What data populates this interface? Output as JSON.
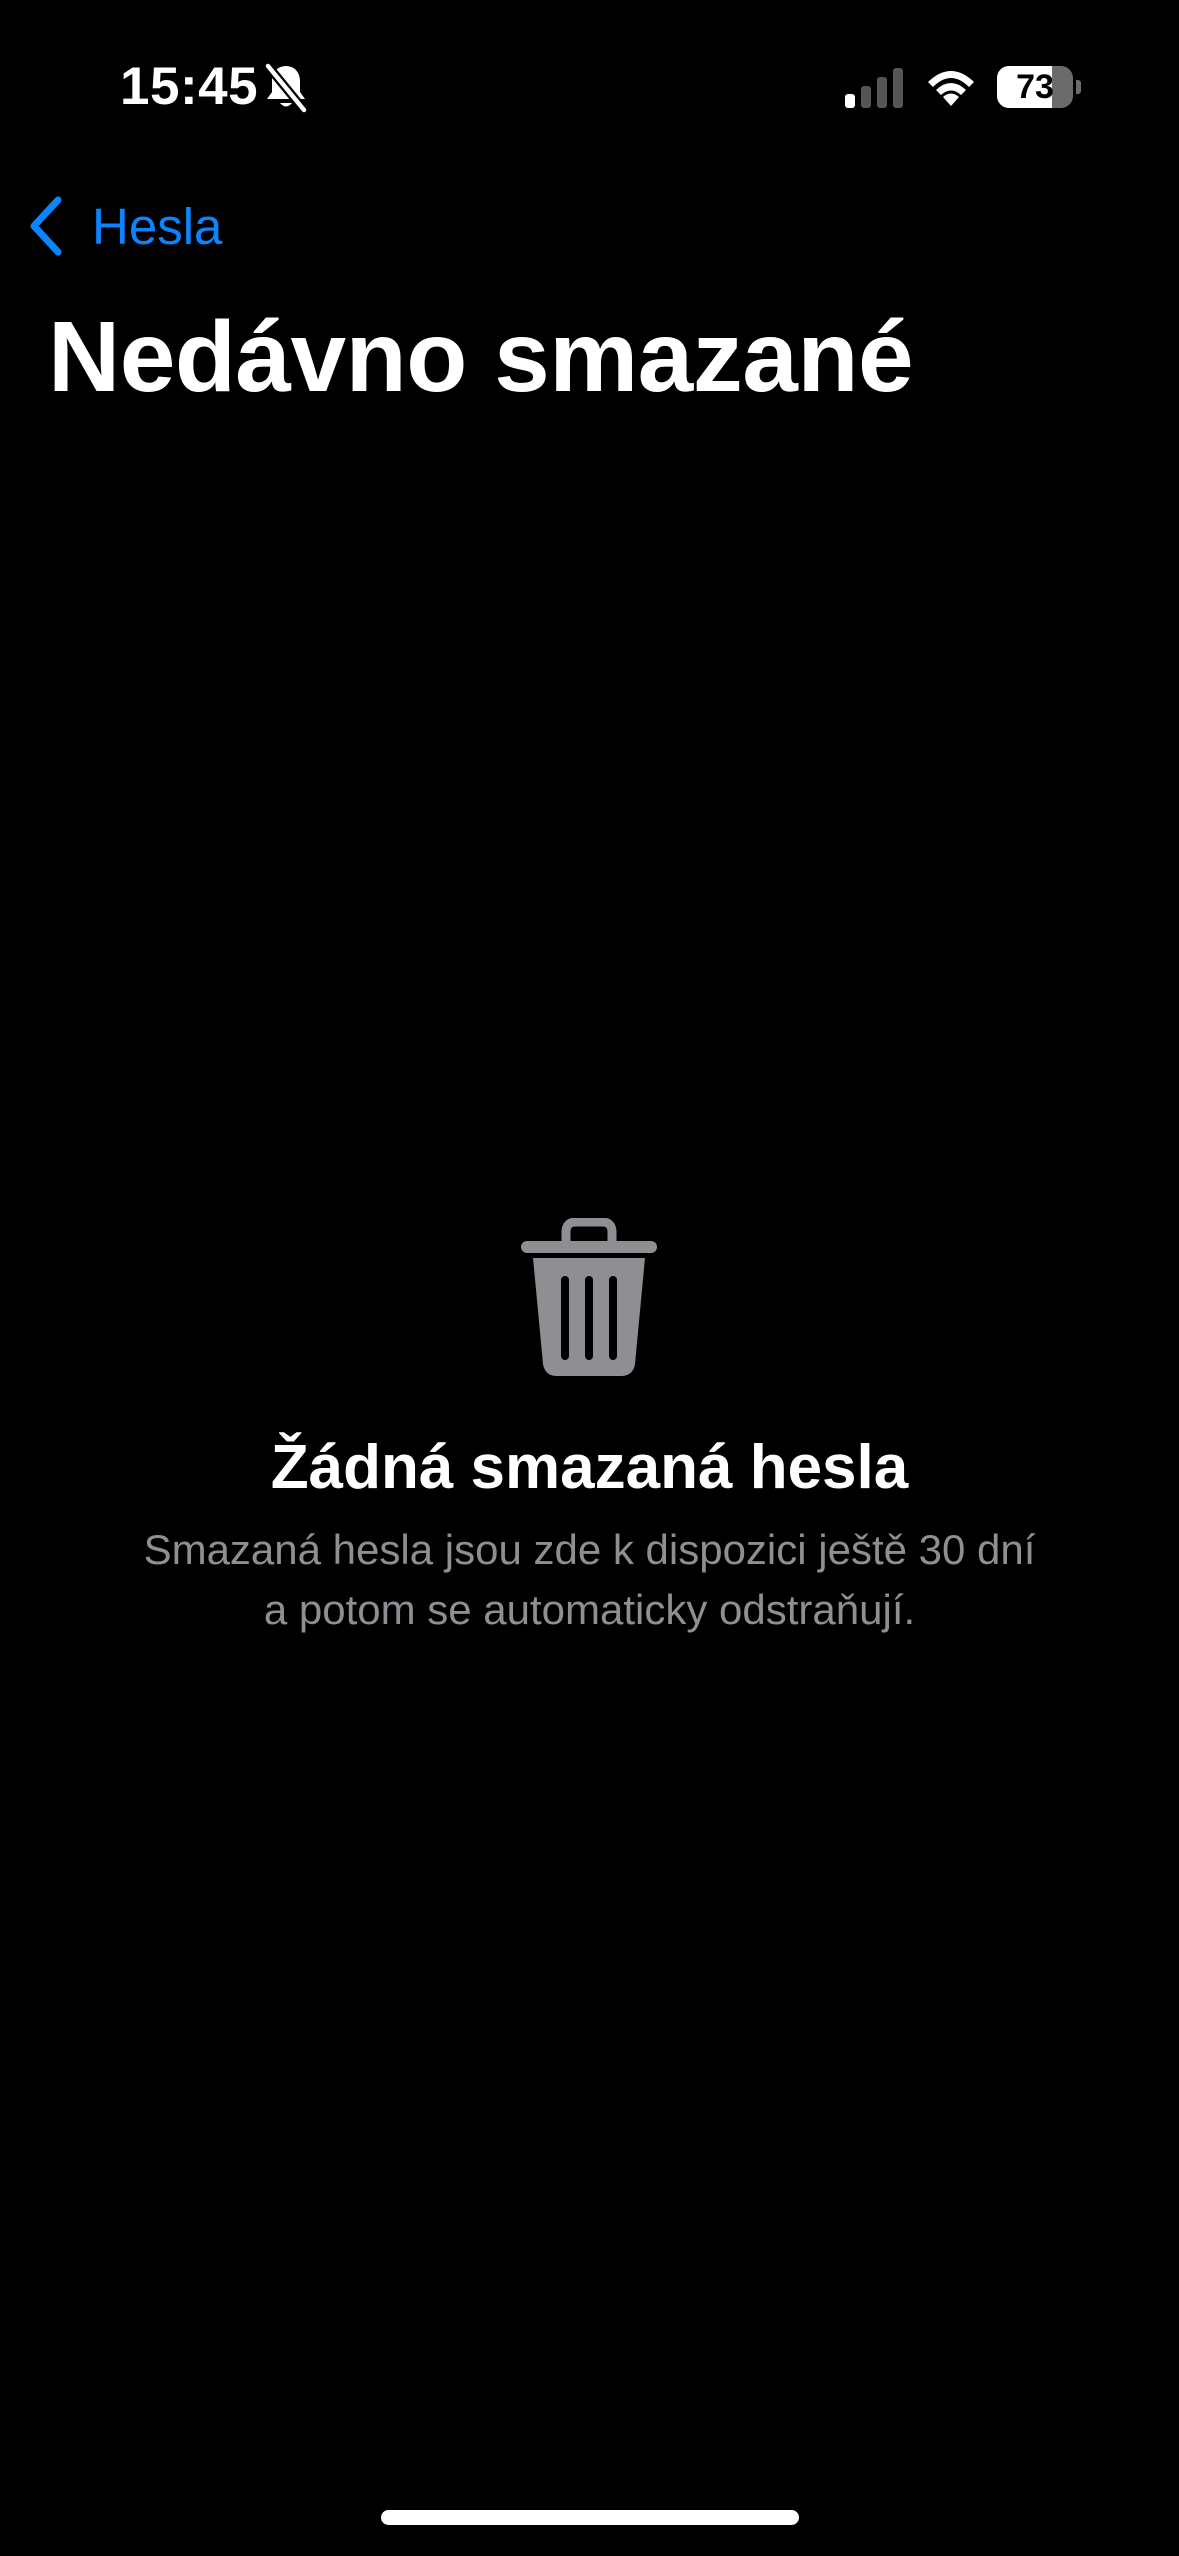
{
  "status_bar": {
    "time": "15:45",
    "battery_level": "73",
    "battery_fraction": 0.73,
    "icons": [
      "bell-slash-icon",
      "cellular-signal-icon",
      "wifi-icon",
      "battery-icon"
    ]
  },
  "nav": {
    "back_label": "Hesla",
    "back_icon": "chevron-left-icon"
  },
  "page": {
    "title": "Nedávno smazané"
  },
  "empty_state": {
    "icon": "trash-icon",
    "title": "Žádná smazaná hesla",
    "description_line1": "Smazaná hesla jsou zde k dispozici ještě 30 dní",
    "description_line2": "a potom se automaticky odstraňují."
  },
  "colors": {
    "background": "#000000",
    "accent": "#0a84ff",
    "secondary_text": "#8e8e93",
    "icon_gray": "#8e8e93"
  }
}
